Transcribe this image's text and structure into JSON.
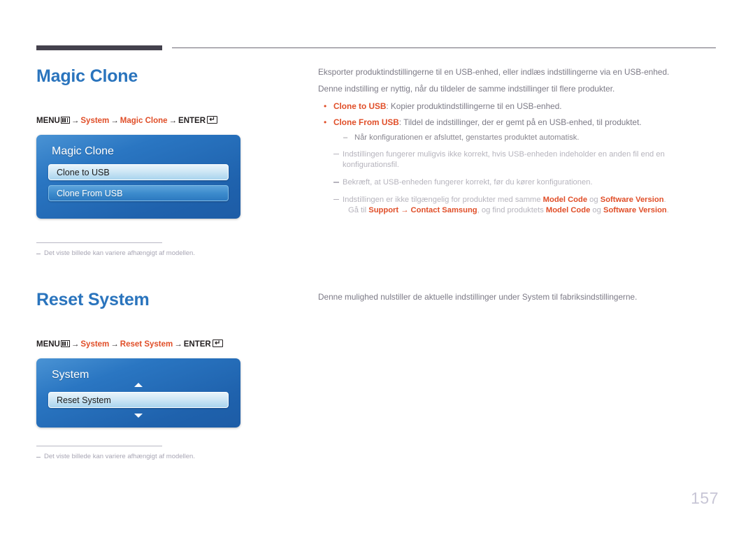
{
  "page": {
    "number": "157"
  },
  "sections": {
    "magic_clone": {
      "heading": "Magic Clone",
      "breadcrumb": {
        "menu_label": "MENU",
        "menu_icon": "menu-grid-icon",
        "arrow": "→",
        "item1": "System",
        "item2": "Magic Clone",
        "enter_label": "ENTER",
        "enter_icon": "enter-return-icon"
      },
      "osd": {
        "title": "Magic Clone",
        "rows": [
          {
            "label": "Clone to USB",
            "state": "selected"
          },
          {
            "label": "Clone From USB",
            "state": "normal"
          }
        ]
      },
      "footnote": "Det viste billede kan variere afhængigt af modellen.",
      "intro": [
        "Eksporter produktindstillingerne til en USB-enhed, eller indlæs indstillingerne via en USB-enhed.",
        "Denne indstilling er nyttig, når du tildeler de samme indstillinger til flere produkter."
      ],
      "bullets": [
        {
          "term": "Clone to USB",
          "text": ": Kopier produktindstillingerne til en USB-enhed."
        },
        {
          "term": "Clone From USB",
          "text": ": Tildel de indstillinger, der er gemt på en USB-enhed, til produktet."
        }
      ],
      "subnote": "Når konfigurationen er afsluttet, genstartes produktet automatisk.",
      "notes": [
        {
          "parts": [
            {
              "t": "Indstillingen fungerer muligvis ikke korrekt, hvis USB-enheden indeholder en anden fil end en konfigurationsfil.",
              "accent": false
            }
          ]
        },
        {
          "parts": [
            {
              "t": "Bekræft, at USB-enheden fungerer korrekt, før du kører konfigurationen.",
              "accent": false
            }
          ]
        },
        {
          "parts": [
            {
              "t": "Indstillingen er ikke tilgængelig for produkter med samme ",
              "accent": false
            },
            {
              "t": "Model Code",
              "accent": true
            },
            {
              "t": " og ",
              "accent": false
            },
            {
              "t": "Software Version",
              "accent": true
            },
            {
              "t": ".",
              "accent": false
            }
          ],
          "second_line": [
            {
              "t": "Gå til ",
              "accent": false
            },
            {
              "t": "Support",
              "accent": true
            },
            {
              "t": " → ",
              "accent": true
            },
            {
              "t": "Contact Samsung",
              "accent": true
            },
            {
              "t": ", og find produktets ",
              "accent": false
            },
            {
              "t": "Model Code",
              "accent": true
            },
            {
              "t": " og ",
              "accent": false
            },
            {
              "t": "Software Version",
              "accent": true
            },
            {
              "t": ".",
              "accent": false
            }
          ]
        }
      ]
    },
    "reset_system": {
      "heading": "Reset System",
      "breadcrumb": {
        "menu_label": "MENU",
        "menu_icon": "menu-grid-icon",
        "arrow": "→",
        "item1": "System",
        "item2": "Reset System",
        "enter_label": "ENTER",
        "enter_icon": "enter-return-icon"
      },
      "osd": {
        "title": "System",
        "scroll_up_icon": "triangle-up-icon",
        "scroll_down_icon": "triangle-down-icon",
        "rows": [
          {
            "label": "Reset System",
            "state": "selected"
          }
        ]
      },
      "footnote": "Det viste billede kan variere afhængigt af modellen.",
      "description": "Denne mulighed nulstiller de aktuelle indstillinger under System til fabriksindstillingerne."
    }
  },
  "colors": {
    "heading_blue": "#2a74bd",
    "accent_orange": "#e04e28",
    "panel_blue": "#2a76c2",
    "body_gray": "#7c7a86"
  }
}
